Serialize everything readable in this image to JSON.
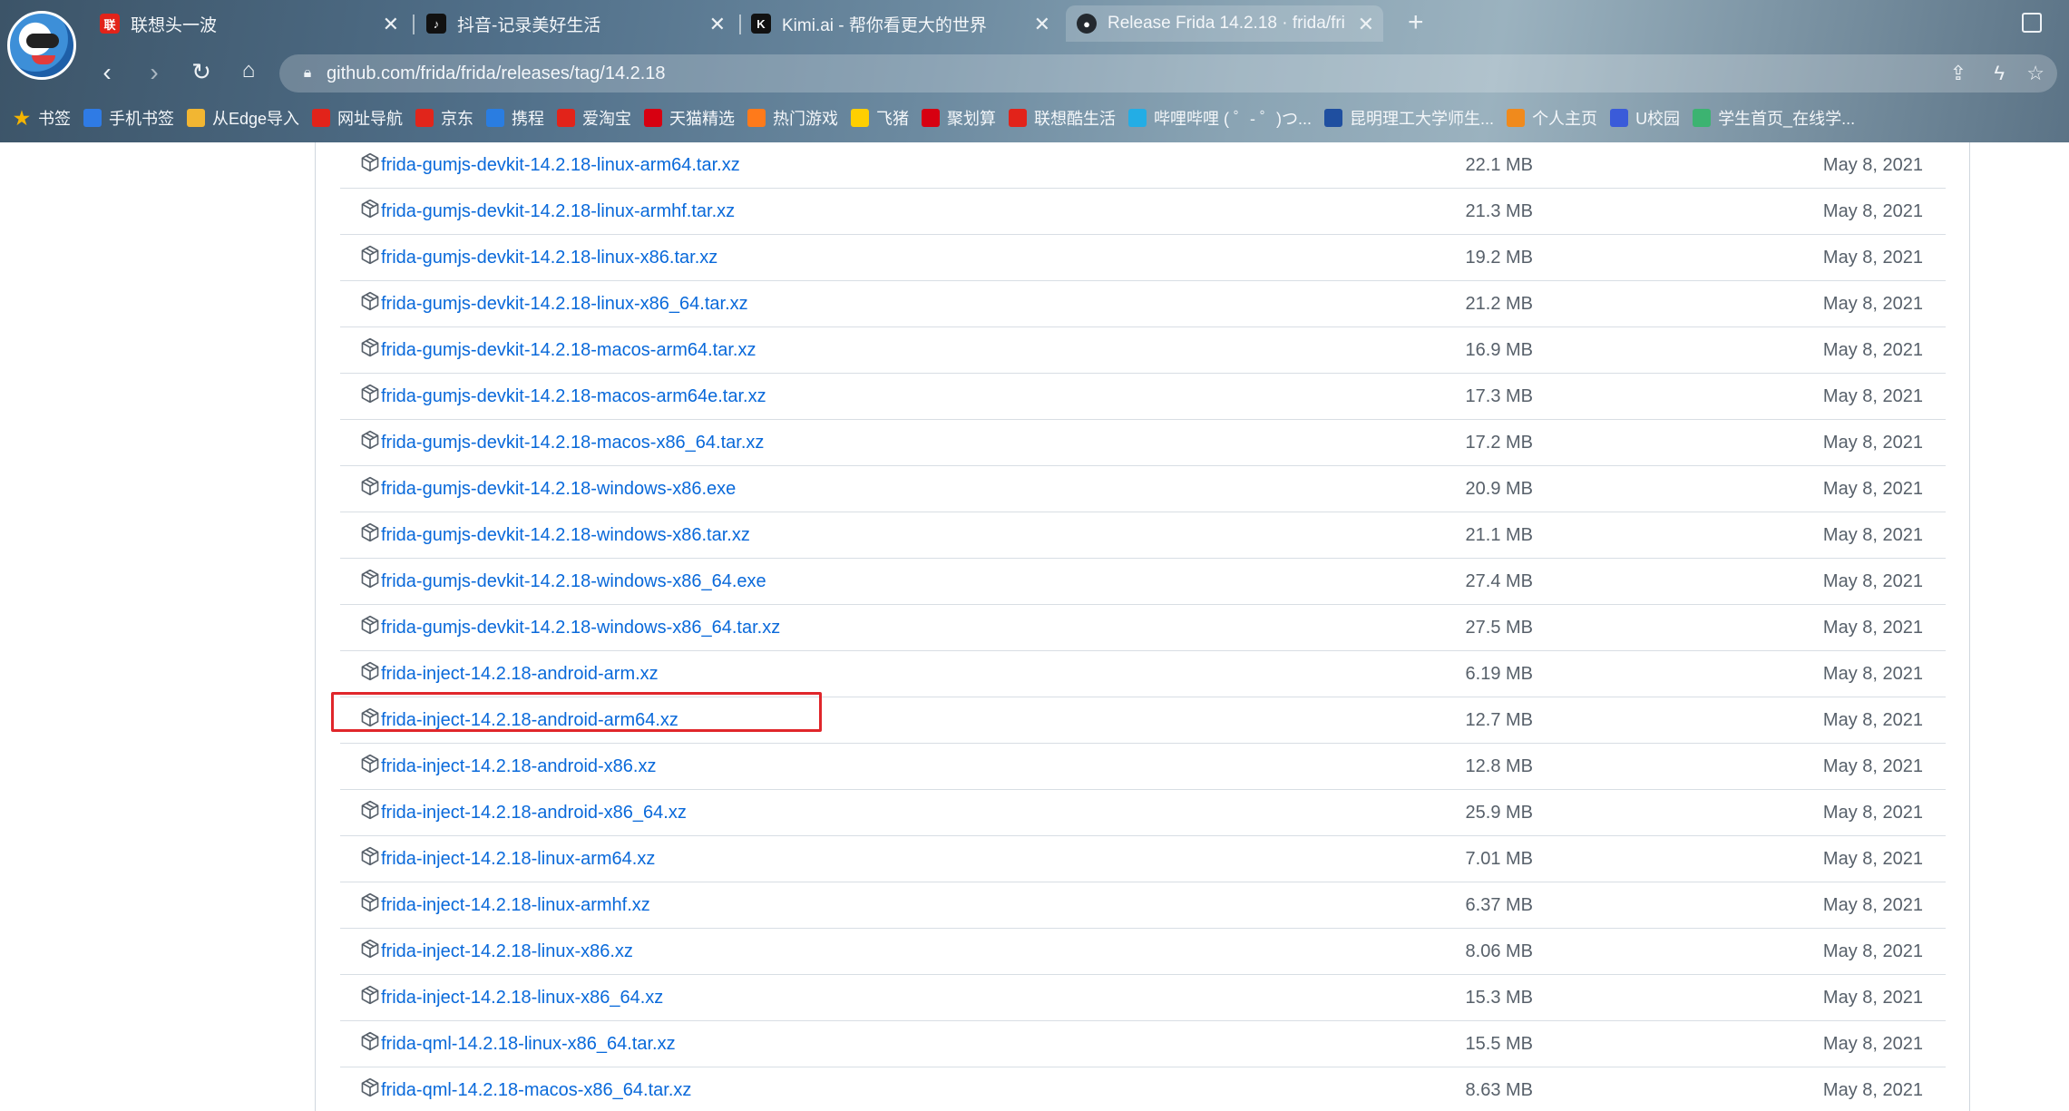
{
  "browser": {
    "tabs": [
      {
        "title": "联想头一波",
        "favicon": "lenovo-icon",
        "color": "#e2231a"
      },
      {
        "title": "抖音-记录美好生活",
        "favicon": "douyin-icon",
        "color": "#111111"
      },
      {
        "title": "Kimi.ai - 帮你看更大的世界",
        "favicon": "kimi-icon",
        "color": "#111111"
      },
      {
        "title": "Release Frida 14.2.18 · frida/fri",
        "favicon": "github-icon",
        "color": "#24292f",
        "active": true
      }
    ],
    "url": "github.com/frida/frida/releases/tag/14.2.18",
    "bookmarks": [
      {
        "label": "书签",
        "icon": "star-icon",
        "color": "#f5b400"
      },
      {
        "label": "手机书签",
        "icon": "phone-icon",
        "color": "#2f7be5"
      },
      {
        "label": "从Edge导入",
        "icon": "folder-icon",
        "color": "#f2b632"
      },
      {
        "label": "网址导航",
        "icon": "lenovo-icon",
        "color": "#e2231a"
      },
      {
        "label": "京东",
        "icon": "jd-icon",
        "color": "#e1251b"
      },
      {
        "label": "携程",
        "icon": "ctrip-icon",
        "color": "#2a7de1"
      },
      {
        "label": "爱淘宝",
        "icon": "taobao-icon",
        "color": "#e2231a"
      },
      {
        "label": "天猫精选",
        "icon": "tmall-icon",
        "color": "#d70011"
      },
      {
        "label": "热门游戏",
        "icon": "game-icon",
        "color": "#ff7a1a"
      },
      {
        "label": "飞猪",
        "icon": "fliggy-icon",
        "color": "#ffcf00"
      },
      {
        "label": "聚划算",
        "icon": "juhuasuan-icon",
        "color": "#d70011"
      },
      {
        "label": "联想酷生活",
        "icon": "lenovo-icon",
        "color": "#e2231a"
      },
      {
        "label": "哔哩哔哩 ( ゜- ゜)つ...",
        "icon": "bilibili-icon",
        "color": "#23ade5"
      },
      {
        "label": "昆明理工大学师生...",
        "icon": "university-icon",
        "color": "#1f4fa0"
      },
      {
        "label": "个人主页",
        "icon": "profile-icon",
        "color": "#f08a1c"
      },
      {
        "label": "U校园",
        "icon": "uxiaoyuan-icon",
        "color": "#3a5bd9"
      },
      {
        "label": "学生首页_在线学...",
        "icon": "chart-icon",
        "color": "#3cb371"
      }
    ]
  },
  "assets": [
    {
      "name": "frida-gumjs-devkit-14.2.18-linux-arm64.tar.xz",
      "size": "22.1 MB",
      "date": "May 8, 2021"
    },
    {
      "name": "frida-gumjs-devkit-14.2.18-linux-armhf.tar.xz",
      "size": "21.3 MB",
      "date": "May 8, 2021"
    },
    {
      "name": "frida-gumjs-devkit-14.2.18-linux-x86.tar.xz",
      "size": "19.2 MB",
      "date": "May 8, 2021"
    },
    {
      "name": "frida-gumjs-devkit-14.2.18-linux-x86_64.tar.xz",
      "size": "21.2 MB",
      "date": "May 8, 2021"
    },
    {
      "name": "frida-gumjs-devkit-14.2.18-macos-arm64.tar.xz",
      "size": "16.9 MB",
      "date": "May 8, 2021"
    },
    {
      "name": "frida-gumjs-devkit-14.2.18-macos-arm64e.tar.xz",
      "size": "17.3 MB",
      "date": "May 8, 2021"
    },
    {
      "name": "frida-gumjs-devkit-14.2.18-macos-x86_64.tar.xz",
      "size": "17.2 MB",
      "date": "May 8, 2021"
    },
    {
      "name": "frida-gumjs-devkit-14.2.18-windows-x86.exe",
      "size": "20.9 MB",
      "date": "May 8, 2021"
    },
    {
      "name": "frida-gumjs-devkit-14.2.18-windows-x86.tar.xz",
      "size": "21.1 MB",
      "date": "May 8, 2021"
    },
    {
      "name": "frida-gumjs-devkit-14.2.18-windows-x86_64.exe",
      "size": "27.4 MB",
      "date": "May 8, 2021"
    },
    {
      "name": "frida-gumjs-devkit-14.2.18-windows-x86_64.tar.xz",
      "size": "27.5 MB",
      "date": "May 8, 2021"
    },
    {
      "name": "frida-inject-14.2.18-android-arm.xz",
      "size": "6.19 MB",
      "date": "May 8, 2021"
    },
    {
      "name": "frida-inject-14.2.18-android-arm64.xz",
      "size": "12.7 MB",
      "date": "May 8, 2021",
      "highlighted": true
    },
    {
      "name": "frida-inject-14.2.18-android-x86.xz",
      "size": "12.8 MB",
      "date": "May 8, 2021"
    },
    {
      "name": "frida-inject-14.2.18-android-x86_64.xz",
      "size": "25.9 MB",
      "date": "May 8, 2021"
    },
    {
      "name": "frida-inject-14.2.18-linux-arm64.xz",
      "size": "7.01 MB",
      "date": "May 8, 2021"
    },
    {
      "name": "frida-inject-14.2.18-linux-armhf.xz",
      "size": "6.37 MB",
      "date": "May 8, 2021"
    },
    {
      "name": "frida-inject-14.2.18-linux-x86.xz",
      "size": "8.06 MB",
      "date": "May 8, 2021"
    },
    {
      "name": "frida-inject-14.2.18-linux-x86_64.xz",
      "size": "15.3 MB",
      "date": "May 8, 2021"
    },
    {
      "name": "frida-qml-14.2.18-linux-x86_64.tar.xz",
      "size": "15.5 MB",
      "date": "May 8, 2021"
    },
    {
      "name": "frida-qml-14.2.18-macos-x86_64.tar.xz",
      "size": "8.63 MB",
      "date": "May 8, 2021"
    }
  ],
  "colors": {
    "link": "#0969da",
    "muted": "#57606a",
    "highlight": "#e0262b"
  }
}
